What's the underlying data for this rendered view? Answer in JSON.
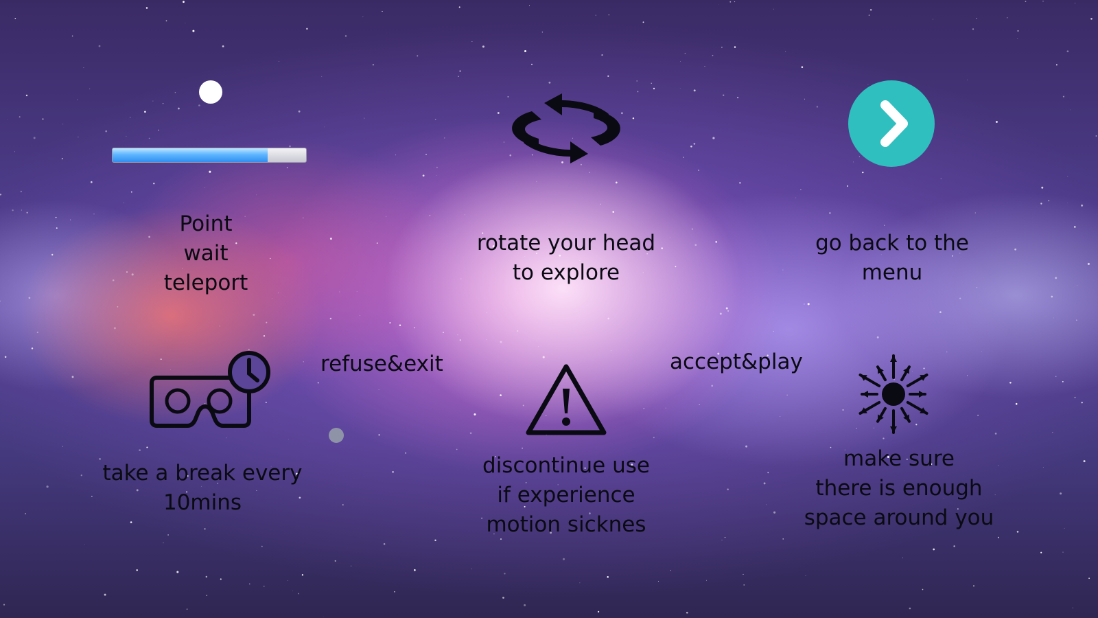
{
  "colors": {
    "accent_teal": "#2fbfbf",
    "progress_blue": "#3a9cf5",
    "text_dark": "#0a0a12"
  },
  "teleport": {
    "label": "Point\nwait\nteleport",
    "progress_fraction": 0.8,
    "pointer_icon": "white-dot-icon"
  },
  "rotate": {
    "label": "rotate your head\nto explore",
    "icon": "rotate-arrows-icon"
  },
  "menu": {
    "label": "go back to the\nmenu",
    "icon": "chevron-right-icon"
  },
  "actions": {
    "refuse_label": "refuse&exit",
    "accept_label": "accept&play"
  },
  "break": {
    "label": "take a break every\n10mins",
    "icon": "vr-headset-clock-icon"
  },
  "warning": {
    "label": "discontinue use\nif experience\nmotion sicknes",
    "icon": "warning-triangle-icon"
  },
  "space": {
    "label": "make sure\nthere is enough\nspace around you",
    "icon": "space-around-arrows-icon"
  }
}
